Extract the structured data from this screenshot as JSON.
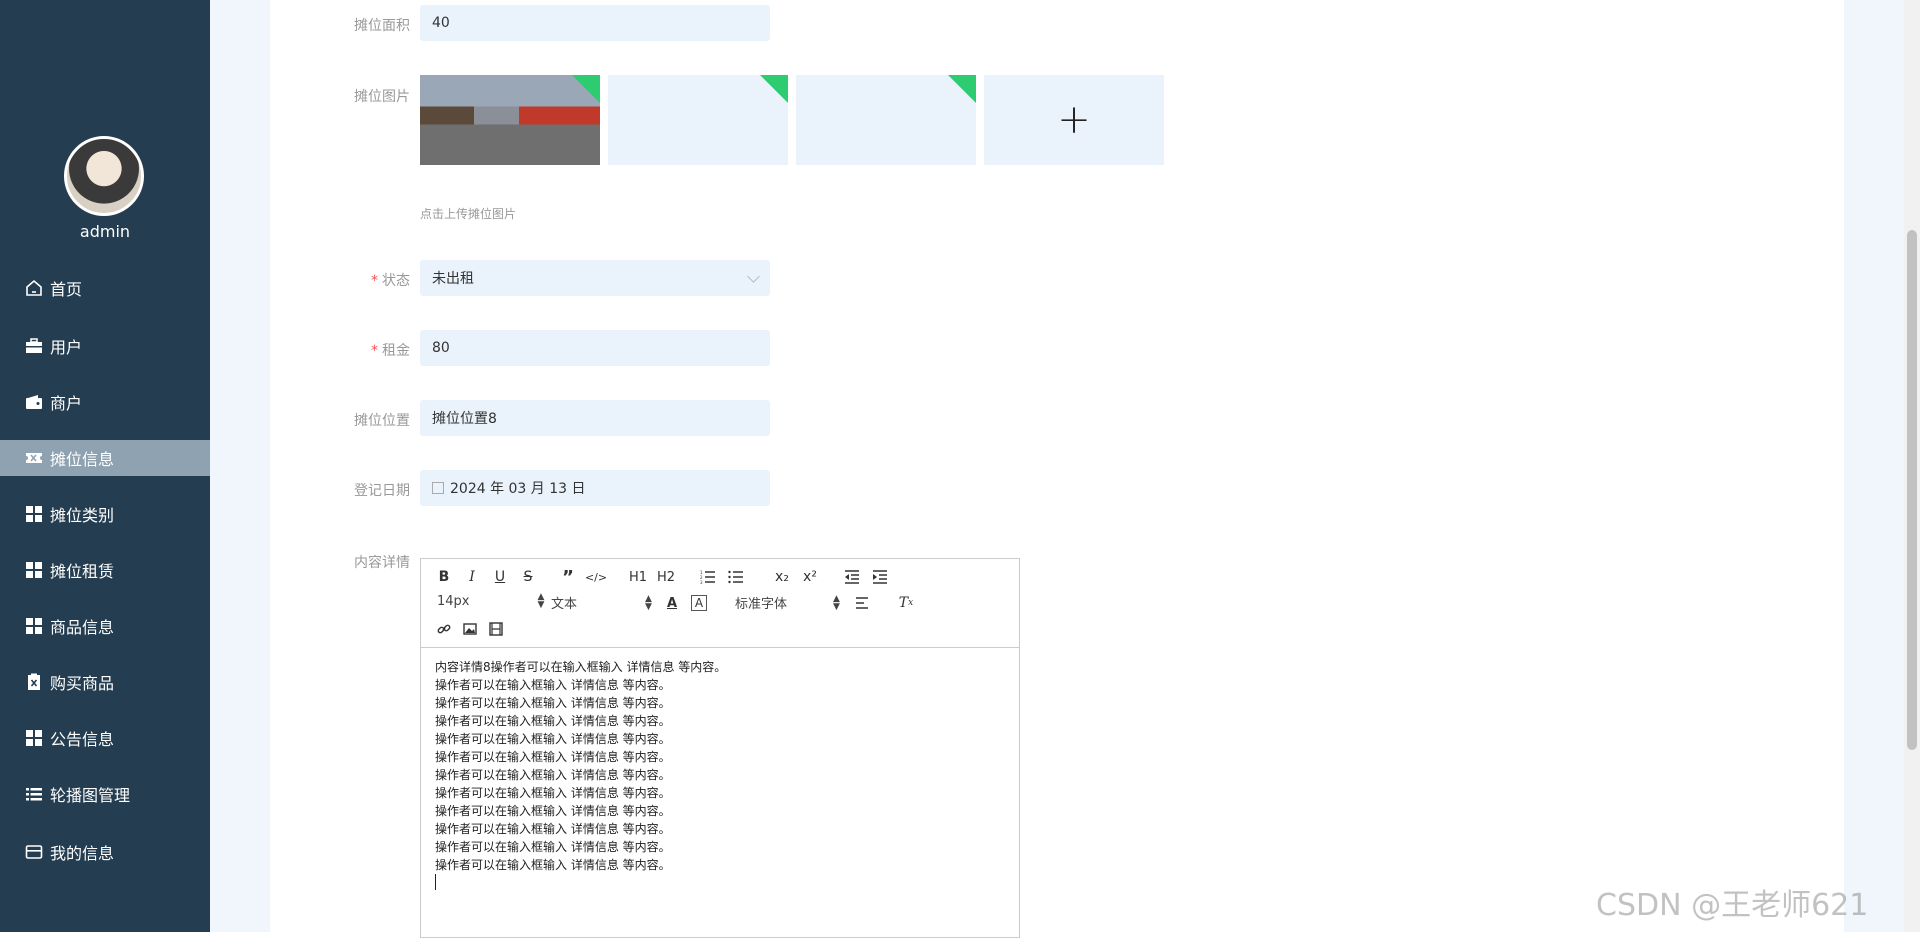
{
  "sidebar": {
    "username": "admin",
    "items": [
      {
        "label": "首页",
        "icon": "home-icon"
      },
      {
        "label": "用户",
        "icon": "briefcase-icon"
      },
      {
        "label": "商户",
        "icon": "wallet-icon"
      },
      {
        "label": "摊位信息",
        "icon": "ticket-icon",
        "active": true
      },
      {
        "label": "摊位类别",
        "icon": "grid-icon"
      },
      {
        "label": "摊位租赁",
        "icon": "grid-icon"
      },
      {
        "label": "商品信息",
        "icon": "grid-icon"
      },
      {
        "label": "购买商品",
        "icon": "clipboard-x-icon"
      },
      {
        "label": "公告信息",
        "icon": "grid-icon"
      },
      {
        "label": "轮播图管理",
        "icon": "list-icon"
      },
      {
        "label": "我的信息",
        "icon": "card-icon"
      }
    ]
  },
  "form": {
    "area_label": "摊位面积",
    "area_value": "40",
    "image_label": "摊位图片",
    "upload_hint": "点击上传摊位图片",
    "status_label": "状态",
    "status_value": "未出租",
    "rent_label": "租金",
    "rent_value": "80",
    "location_label": "摊位位置",
    "location_value": "摊位位置8",
    "date_label": "登记日期",
    "date_value": "2024 年 03 月 13 日",
    "content_label": "内容详情"
  },
  "editor": {
    "font_size": "14px",
    "text_type": "文本",
    "font_family": "标准字体",
    "toolbar_buttons": [
      "B",
      "I",
      "U",
      "S",
      "”",
      "</>",
      "H1",
      "H2",
      "ordered-list",
      "bullet-list",
      "x₂",
      "x²",
      "outdent",
      "indent"
    ],
    "lines": [
      "内容详情8操作者可以在输入框输入 详情信息 等内容。",
      "操作者可以在输入框输入 详情信息 等内容。",
      "操作者可以在输入框输入 详情信息 等内容。",
      "操作者可以在输入框输入 详情信息 等内容。",
      "操作者可以在输入框输入 详情信息 等内容。",
      "操作者可以在输入框输入 详情信息 等内容。",
      "操作者可以在输入框输入 详情信息 等内容。",
      "操作者可以在输入框输入 详情信息 等内容。",
      "操作者可以在输入框输入 详情信息 等内容。",
      "操作者可以在输入框输入 详情信息 等内容。",
      "操作者可以在输入框输入 详情信息 等内容。",
      "操作者可以在输入框输入 详情信息 等内容。"
    ]
  },
  "watermark": "CSDN @王老师621"
}
